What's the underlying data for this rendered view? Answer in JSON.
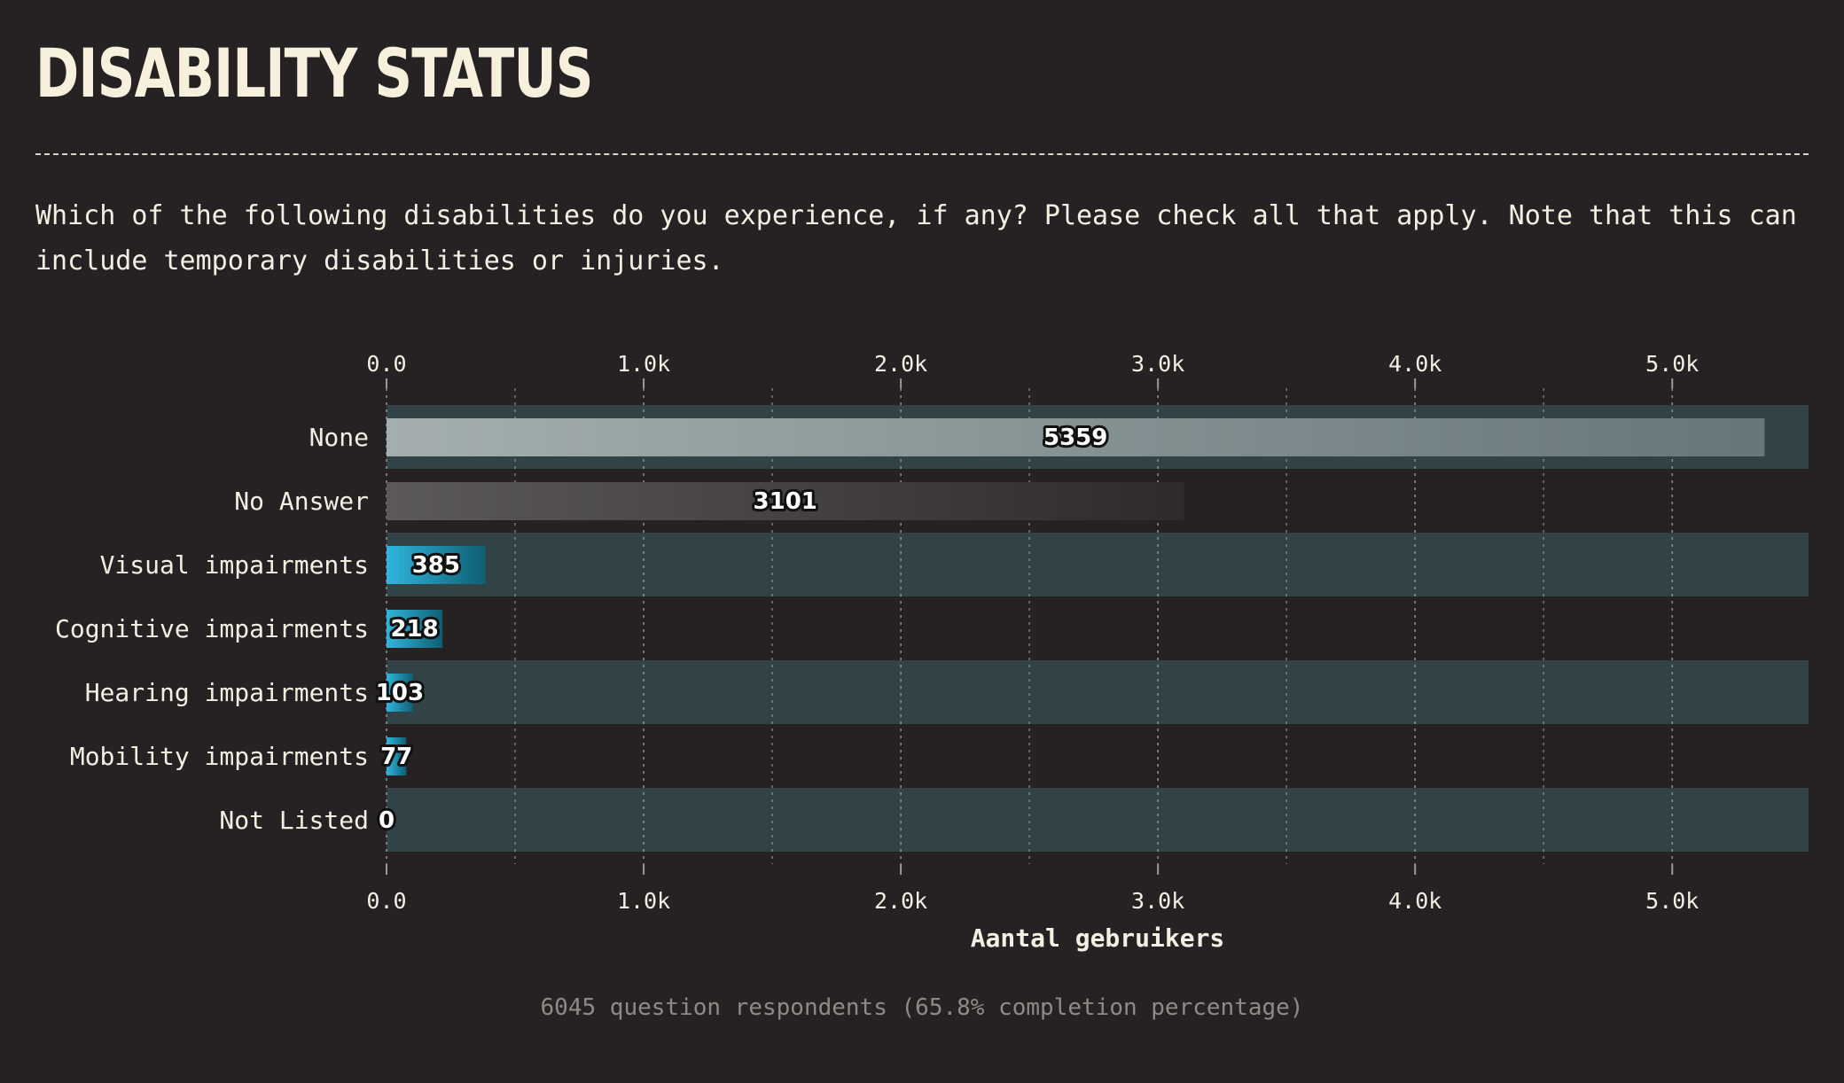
{
  "header": {
    "title": "DISABILITY STATUS",
    "question": "Which of the following disabilities do you experience, if any? Please check all that apply. Note that this can include temporary disabilities or injuries."
  },
  "chart_data": {
    "type": "bar",
    "orientation": "horizontal",
    "categories": [
      "None",
      "No Answer",
      "Visual impairments",
      "Cognitive impairments",
      "Hearing impairments",
      "Mobility impairments",
      "Not Listed"
    ],
    "values": [
      5359,
      3101,
      385,
      218,
      103,
      77,
      0
    ],
    "value_labels": [
      "5359",
      "3101",
      "385",
      "218",
      "103",
      "77",
      "0"
    ],
    "xlabel": "Aantal gebruikers",
    "xlim": [
      0,
      5530
    ],
    "ticks": [
      0,
      1000,
      2000,
      3000,
      4000,
      5000
    ],
    "tick_labels": [
      "0.0",
      "1.0k",
      "2.0k",
      "3.0k",
      "4.0k",
      "5.0k"
    ],
    "minor_gridlines": [
      500,
      1500,
      2500,
      3500,
      4500
    ],
    "axis_position": "top-and-bottom",
    "grid": true,
    "bar_styles": [
      "light-gradient",
      "dark-gradient",
      "accent",
      "accent",
      "accent",
      "accent",
      "accent"
    ],
    "colors": {
      "background": "#262223",
      "band": "#314347",
      "light_start": "#a4aeae",
      "light_end": "#66767a",
      "dark_start": "#5c595a",
      "dark_end": "#2f2b2c",
      "accent_start": "#2fb6dd",
      "accent_end": "#0f5f72",
      "grid": "#9a9a9a",
      "text": "#f3efe3"
    }
  },
  "footer": {
    "note": "6045 question respondents (65.8% completion percentage)"
  }
}
